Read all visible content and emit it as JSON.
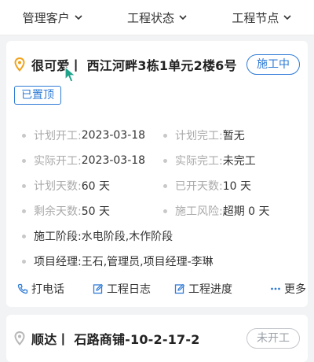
{
  "filters": [
    {
      "label": "管理客户"
    },
    {
      "label": "工程状态"
    },
    {
      "label": "工程节点"
    }
  ],
  "project1": {
    "title": "很可爱丨 西江河畔3栋1单元2楼6号",
    "status": "施工中",
    "pinned": "已置顶",
    "details": {
      "plan_start_label": "计划开工:",
      "plan_start_value": "2023-03-18",
      "plan_end_label": "计划完工:",
      "plan_end_value": "暂无",
      "actual_start_label": "实际开工:",
      "actual_start_value": "2023-03-18",
      "actual_end_label": "实际完工:",
      "actual_end_value": "未完工",
      "plan_days_label": "计划天数:",
      "plan_days_value": "60 天",
      "opened_days_label": "已开天数:",
      "opened_days_value": "10 天",
      "remaining_days_label": "剩余天数:",
      "remaining_days_value": "50 天",
      "risk_label": "施工风险:",
      "risk_value": "超期 0 天",
      "stage_label": "施工阶段:",
      "stage_value": "水电阶段,木作阶段",
      "manager_label": "项目经理:",
      "manager_value": "王石,管理员,项目经理-李琳"
    },
    "actions": {
      "call": "打电话",
      "log": "工程日志",
      "progress": "工程进度",
      "more": "更多"
    }
  },
  "project2": {
    "title": "顺达丨 石路商铺-10-2-17-2",
    "status": "未开工"
  },
  "colors": {
    "accent": "#2f7bd6",
    "pin": "#f0a21b",
    "background": "#f2f3f5"
  }
}
